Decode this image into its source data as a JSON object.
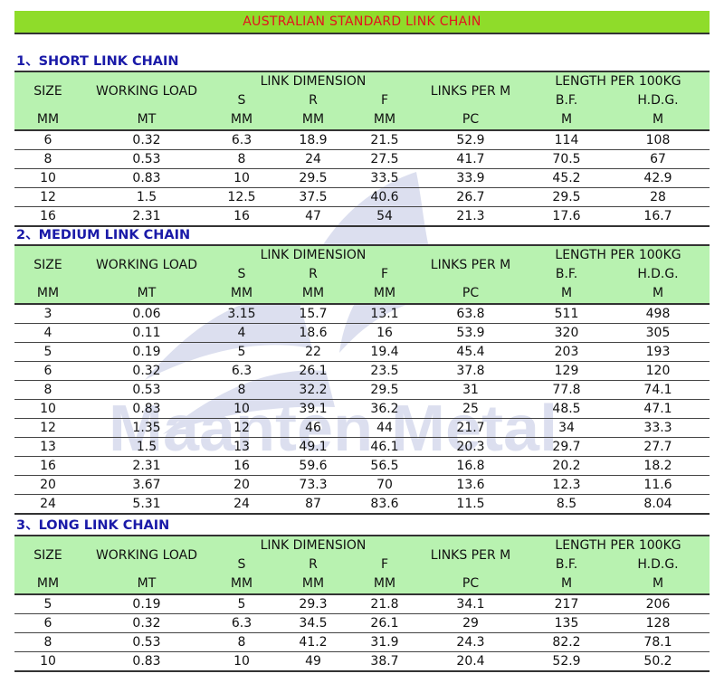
{
  "title": "AUSTRALIAN STANDARD LINK CHAIN",
  "watermark_text": "Maanten Metal",
  "headers": {
    "size": "SIZE",
    "working_load": "WORKING LOAD",
    "link_dimension": "LINK DIMENSION",
    "s": "S",
    "r": "R",
    "f": "F",
    "links_per_m": "LINKS PER M",
    "length_per_100kg": "LENGTH PER 100KG",
    "bf": "B.F.",
    "hdg": "H.D.G.",
    "units": [
      "MM",
      "MT",
      "MM",
      "MM",
      "MM",
      "PC",
      "M",
      "M"
    ]
  },
  "sections": [
    {
      "title": "1、SHORT LINK CHAIN",
      "rows": [
        [
          "6",
          "0.32",
          "6.3",
          "18.9",
          "21.5",
          "52.9",
          "114",
          "108"
        ],
        [
          "8",
          "0.53",
          "8",
          "24",
          "27.5",
          "41.7",
          "70.5",
          "67"
        ],
        [
          "10",
          "0.83",
          "10",
          "29.5",
          "33.5",
          "33.9",
          "45.2",
          "42.9"
        ],
        [
          "12",
          "1.5",
          "12.5",
          "37.5",
          "40.6",
          "26.7",
          "29.5",
          "28"
        ],
        [
          "16",
          "2.31",
          "16",
          "47",
          "54",
          "21.3",
          "17.6",
          "16.7"
        ]
      ]
    },
    {
      "title": "2、MEDIUM LINK CHAIN",
      "rows": [
        [
          "3",
          "0.06",
          "3.15",
          "15.7",
          "13.1",
          "63.8",
          "511",
          "498"
        ],
        [
          "4",
          "0.11",
          "4",
          "18.6",
          "16",
          "53.9",
          "320",
          "305"
        ],
        [
          "5",
          "0.19",
          "5",
          "22",
          "19.4",
          "45.4",
          "203",
          "193"
        ],
        [
          "6",
          "0.32",
          "6.3",
          "26.1",
          "23.5",
          "37.8",
          "129",
          "120"
        ],
        [
          "8",
          "0.53",
          "8",
          "32.2",
          "29.5",
          "31",
          "77.8",
          "74.1"
        ],
        [
          "10",
          "0.83",
          "10",
          "39.1",
          "36.2",
          "25",
          "48.5",
          "47.1"
        ],
        [
          "12",
          "1.35",
          "12",
          "46",
          "44",
          "21.7",
          "34",
          "33.3"
        ],
        [
          "13",
          "1.5",
          "13",
          "49.1",
          "46.1",
          "20.3",
          "29.7",
          "27.7"
        ],
        [
          "16",
          "2.31",
          "16",
          "59.6",
          "56.5",
          "16.8",
          "20.2",
          "18.2"
        ],
        [
          "20",
          "3.67",
          "20",
          "73.3",
          "70",
          "13.6",
          "12.3",
          "11.6"
        ],
        [
          "24",
          "5.31",
          "24",
          "87",
          "83.6",
          "11.5",
          "8.5",
          "8.04"
        ]
      ]
    },
    {
      "title": "3、LONG LINK CHAIN",
      "rows": [
        [
          "5",
          "0.19",
          "5",
          "29.3",
          "21.8",
          "34.1",
          "217",
          "206"
        ],
        [
          "6",
          "0.32",
          "6.3",
          "34.5",
          "26.1",
          "29",
          "135",
          "128"
        ],
        [
          "8",
          "0.53",
          "8",
          "41.2",
          "31.9",
          "24.3",
          "82.2",
          "78.1"
        ],
        [
          "10",
          "0.83",
          "10",
          "49",
          "38.7",
          "20.4",
          "52.9",
          "50.2"
        ]
      ]
    }
  ]
}
